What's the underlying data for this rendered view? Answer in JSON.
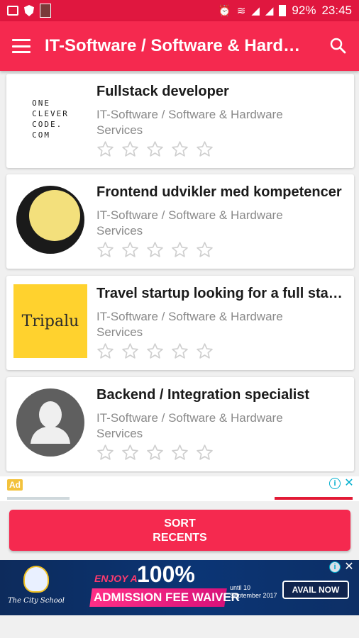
{
  "status_bar": {
    "battery": "92%",
    "time": "23:45"
  },
  "app_bar": {
    "title": "IT-Software / Software & Hardware Services"
  },
  "jobs": [
    {
      "title": "Fullstack developer",
      "category": "IT-Software / Software & Hardware Services",
      "logo": "one-clever-code-logo",
      "logo_text": "ONE\nCLEVER\nCODE.\nCOM",
      "rating": 0
    },
    {
      "title": "Frontend udvikler med kompetencer",
      "category": "IT-Software / Software & Hardware Services",
      "logo": "yellow-circle-logo",
      "rating": 0
    },
    {
      "title": "Travel startup looking for a full stack developer",
      "category": "IT-Software / Software & Hardware Services",
      "logo": "tripalu-logo",
      "logo_text": "Tripalu",
      "rating": 0
    },
    {
      "title": "Backend / Integration specialist",
      "category": "IT-Software / Software & Hardware Services",
      "logo": "person-placeholder-icon",
      "rating": 0
    }
  ],
  "ad": {
    "badge": "Ad"
  },
  "sort_button": {
    "line1": "SORT",
    "line2": "RECENTS"
  },
  "banner": {
    "school": "The City School",
    "enjoy": "ENJOY A",
    "percent": "100%",
    "offer": "ADMISSION FEE WAIVER",
    "until": "until 10 September 2017",
    "cta": "AVAIL NOW"
  },
  "colors": {
    "primary": "#f5294f",
    "status_bar": "#e0173f",
    "star_outline": "#cfcfcf"
  }
}
